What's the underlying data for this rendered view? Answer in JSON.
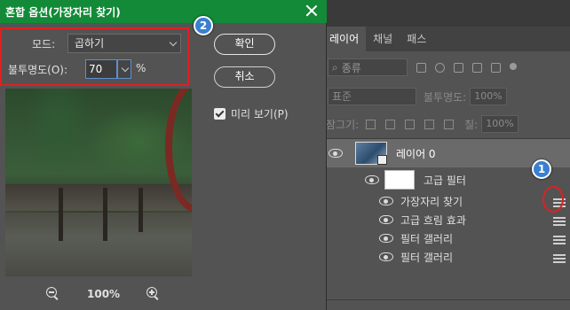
{
  "dialog": {
    "title": "혼합 옵션(가장자리 찾기)",
    "mode_label": "모드:",
    "mode_value": "곱하기",
    "opacity_label": "불투명도(O):",
    "opacity_value": "70",
    "opacity_unit": "%",
    "ok_label": "확인",
    "cancel_label": "취소",
    "preview_label": "미리 보기(P)",
    "preview_checked": true,
    "zoom_level": "100%"
  },
  "layers_panel": {
    "tabs": [
      "레이어",
      "채널",
      "패스"
    ],
    "active_tab": "레이어",
    "filter_kind": "종류",
    "blend_mode": "표준",
    "opacity_label": "불투명도:",
    "opacity_value": "100%",
    "lock_label": "잠그기:",
    "fill_label": "칠:",
    "fill_value": "100%",
    "layer_name": "레이어 0",
    "smart_filters_label": "고급 필터",
    "filters": [
      "가장자리 찾기",
      "고급 흐림 효과",
      "필터 갤러리",
      "필터 갤러리"
    ]
  },
  "annotations": {
    "badge_1": "1",
    "badge_2": "2",
    "highlight_color": "#e02020",
    "badge_color": "#3a7fd0"
  },
  "colors": {
    "title_bar": "#128a37",
    "panel_bg": "#535353"
  }
}
